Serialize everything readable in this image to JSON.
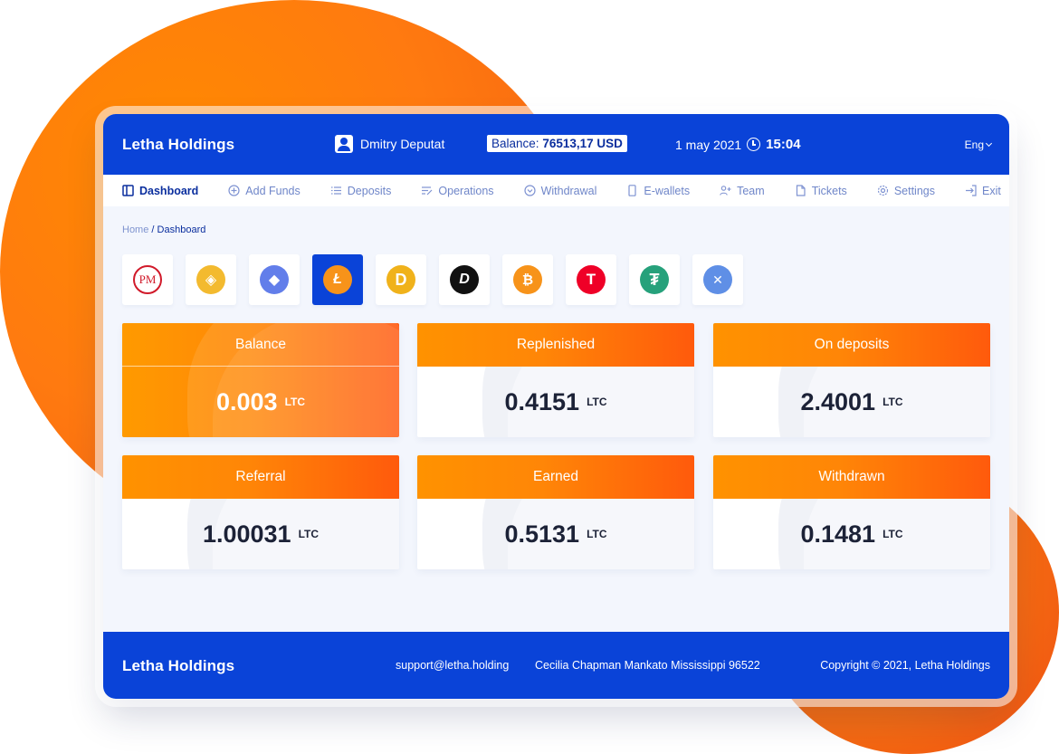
{
  "app": {
    "brand": "Letha Holdings"
  },
  "header": {
    "user_name": "Dmitry Deputat",
    "balance_label": "Balance:",
    "balance_value": "76513,17 USD",
    "date": "1 may 2021",
    "time": "15:04",
    "language": "Eng"
  },
  "nav": {
    "items": [
      {
        "label": "Dashboard",
        "icon": "layout-icon",
        "active": true
      },
      {
        "label": "Add Funds",
        "icon": "plus-circle-icon"
      },
      {
        "label": "Deposits",
        "icon": "list-icon"
      },
      {
        "label": "Operations",
        "icon": "edit-list-icon"
      },
      {
        "label": "Withdrawal",
        "icon": "chevron-circle-icon"
      },
      {
        "label": "E-wallets",
        "icon": "phone-icon"
      },
      {
        "label": "Team",
        "icon": "user-plus-icon"
      },
      {
        "label": "Tickets",
        "icon": "file-icon"
      },
      {
        "label": "Settings",
        "icon": "gear-icon"
      },
      {
        "label": "Exit",
        "icon": "exit-icon"
      }
    ]
  },
  "breadcrumb": {
    "home": "Home",
    "separator": "/",
    "current": "Dashboard"
  },
  "currencies": [
    {
      "name": "perfect-money",
      "glyph": "PM",
      "color": "#d11a2a"
    },
    {
      "name": "binance",
      "glyph": "◈",
      "color": "#f3ba2f"
    },
    {
      "name": "ethereum",
      "glyph": "◆",
      "color": "#627eea"
    },
    {
      "name": "litecoin",
      "glyph": "Ł",
      "color": "#f7931a",
      "active": true
    },
    {
      "name": "dogecoin",
      "glyph": "D",
      "color": "#f0b21b"
    },
    {
      "name": "dash",
      "glyph": "D",
      "color": "#111111"
    },
    {
      "name": "bitcoin",
      "glyph": "₿",
      "color": "#f7931a"
    },
    {
      "name": "tron",
      "glyph": "T",
      "color": "#ef0027"
    },
    {
      "name": "tether",
      "glyph": "₮",
      "color": "#26a17b"
    },
    {
      "name": "ripple",
      "glyph": "✕",
      "color": "#5f8fe6"
    }
  ],
  "stats": {
    "unit": "LTC",
    "balance": {
      "label": "Balance",
      "value": "0.003"
    },
    "replenished": {
      "label": "Replenished",
      "value": "0.4151"
    },
    "on_deposits": {
      "label": "On deposits",
      "value": "2.4001"
    },
    "referral": {
      "label": "Referral",
      "value": "1.00031"
    },
    "earned": {
      "label": "Earned",
      "value": "0.5131"
    },
    "withdrawn": {
      "label": "Withdrawn",
      "value": "0.1481"
    }
  },
  "footer": {
    "brand": "Letha Holdings",
    "email": "support@letha.holding",
    "address": "Cecilia Chapman Mankato Mississippi 96522",
    "copyright": "Copyright © 2021, Letha Holdings"
  },
  "colors": {
    "primary": "#0a43d8",
    "accent": "#ff8607",
    "accent_end": "#ff5a0c"
  }
}
